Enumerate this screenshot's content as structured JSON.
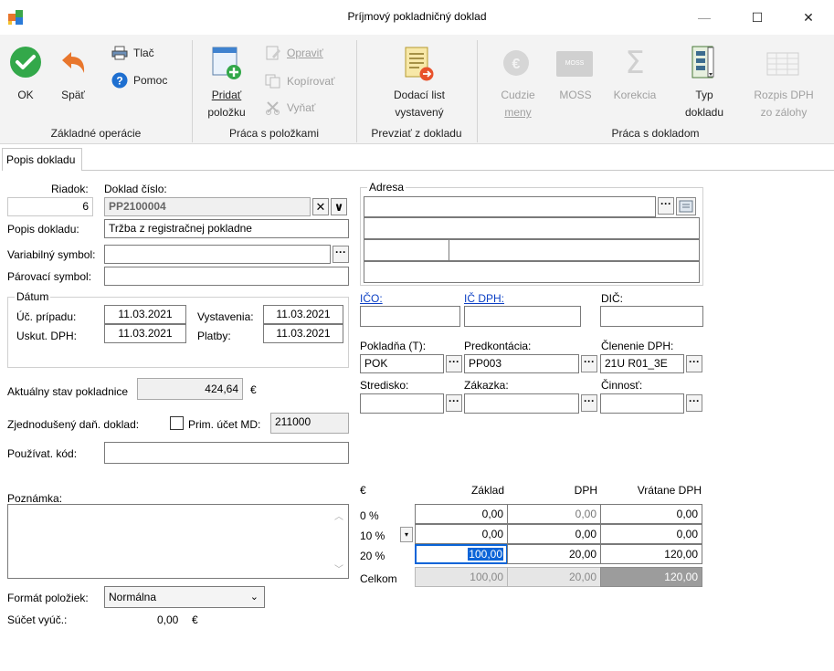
{
  "window": {
    "title": "Príjmový pokladničný doklad",
    "minimize": "—",
    "maximize": "☐",
    "close": "✕"
  },
  "ribbon": {
    "ok": "OK",
    "back": "Späť",
    "print": "Tlač",
    "help": "Pomoc",
    "group_basic": "Základné operácie",
    "add_item_1": "Pridať",
    "add_item_2": "položku",
    "edit": "Opraviť",
    "copy": "Kopírovať",
    "remove": "Vyňať",
    "group_items": "Práca s položkami",
    "delivery_1": "Dodací list",
    "delivery_2": "vystavený",
    "group_take": "Prevziať z dokladu",
    "foreign_1": "Cudzie",
    "foreign_2": "meny",
    "moss": "MOSS",
    "correction": "Korekcia",
    "doctype_1": "Typ",
    "doctype_2": "dokladu",
    "vat_split_1": "Rozpis DPH",
    "vat_split_2": "zo zálohy",
    "group_doc": "Práca s dokladom",
    "moss_badge": "MOSS"
  },
  "tabs": [
    "Popis dokladu"
  ],
  "form": {
    "row_label": "Riadok:",
    "row_value": "6",
    "docnum_label": "Doklad číslo:",
    "docnum_value": "PP2100004",
    "clear_btn": "✕",
    "dropdown_btn": "∨",
    "desc_label": "Popis dokladu:",
    "desc_value": "Tržba z registračnej pokladne",
    "vs_label": "Variabilný symbol:",
    "vs_value": "",
    "pair_label": "Párovací symbol:",
    "pair_value": "",
    "date_group": "Dátum",
    "acc_date_label": "Úč. prípadu:",
    "acc_date_value": "11.03.2021",
    "issue_label": "Vystavenia:",
    "issue_value": "11.03.2021",
    "vat_date_label": "Uskut. DPH:",
    "vat_date_value": "11.03.2021",
    "pay_label": "Platby:",
    "pay_value": "11.03.2021",
    "cash_state_label": "Aktuálny stav pokladnice",
    "cash_state_value": "424,64",
    "currency": "€",
    "simplified_label": "Zjednodušený daň. doklad:",
    "prim_label": "Prim. účet MD:",
    "prim_value": "211000",
    "user_code_label": "Používat. kód:",
    "user_code_value": "",
    "note_label": "Poznámka:",
    "note_value": "",
    "format_label": "Formát položiek:",
    "format_value": "Normálna",
    "sum_label": "Súčet vyúč.:",
    "sum_value": "0,00",
    "sum_currency": "€"
  },
  "address": {
    "group": "Adresa",
    "line1": "",
    "line2": "",
    "zip": "",
    "city": "",
    "country": "",
    "ico_label": "IČO:",
    "ico_value": "",
    "icdph_label": "IČ DPH:",
    "icdph_value": "",
    "dic_label": "DIČ:",
    "dic_value": ""
  },
  "accounting": {
    "cashbox_label": "Pokladňa (T):",
    "cashbox_value": "POK",
    "precont_label": "Predkontácia:",
    "precont_value": "PP003",
    "vatsplit_label": "Členenie DPH:",
    "vatsplit_value": "21U R01_3E",
    "center_label": "Stredisko:",
    "center_value": "",
    "order_label": "Zákazka:",
    "order_value": "",
    "activity_label": "Činnosť:",
    "activity_value": ""
  },
  "totals": {
    "currency": "€",
    "col_base": "Základ",
    "col_vat": "DPH",
    "col_incl": "Vrátane DPH",
    "rows": [
      {
        "rate": "0 %",
        "base": "0,00",
        "vat": "0,00",
        "incl": "0,00"
      },
      {
        "rate": "10 %",
        "base": "0,00",
        "vat": "0,00",
        "incl": "0,00"
      },
      {
        "rate": "20 %",
        "base": "100,00",
        "vat": "20,00",
        "incl": "120,00"
      }
    ],
    "total_label": "Celkom",
    "total_base": "100,00",
    "total_vat": "20,00",
    "total_incl": "120,00"
  },
  "colors": {
    "ok_green": "#33a84a",
    "back_orange": "#e8762c",
    "help_blue": "#1e6fd0",
    "link_blue": "#0b3fc4",
    "selection_blue": "#0a64d8"
  }
}
